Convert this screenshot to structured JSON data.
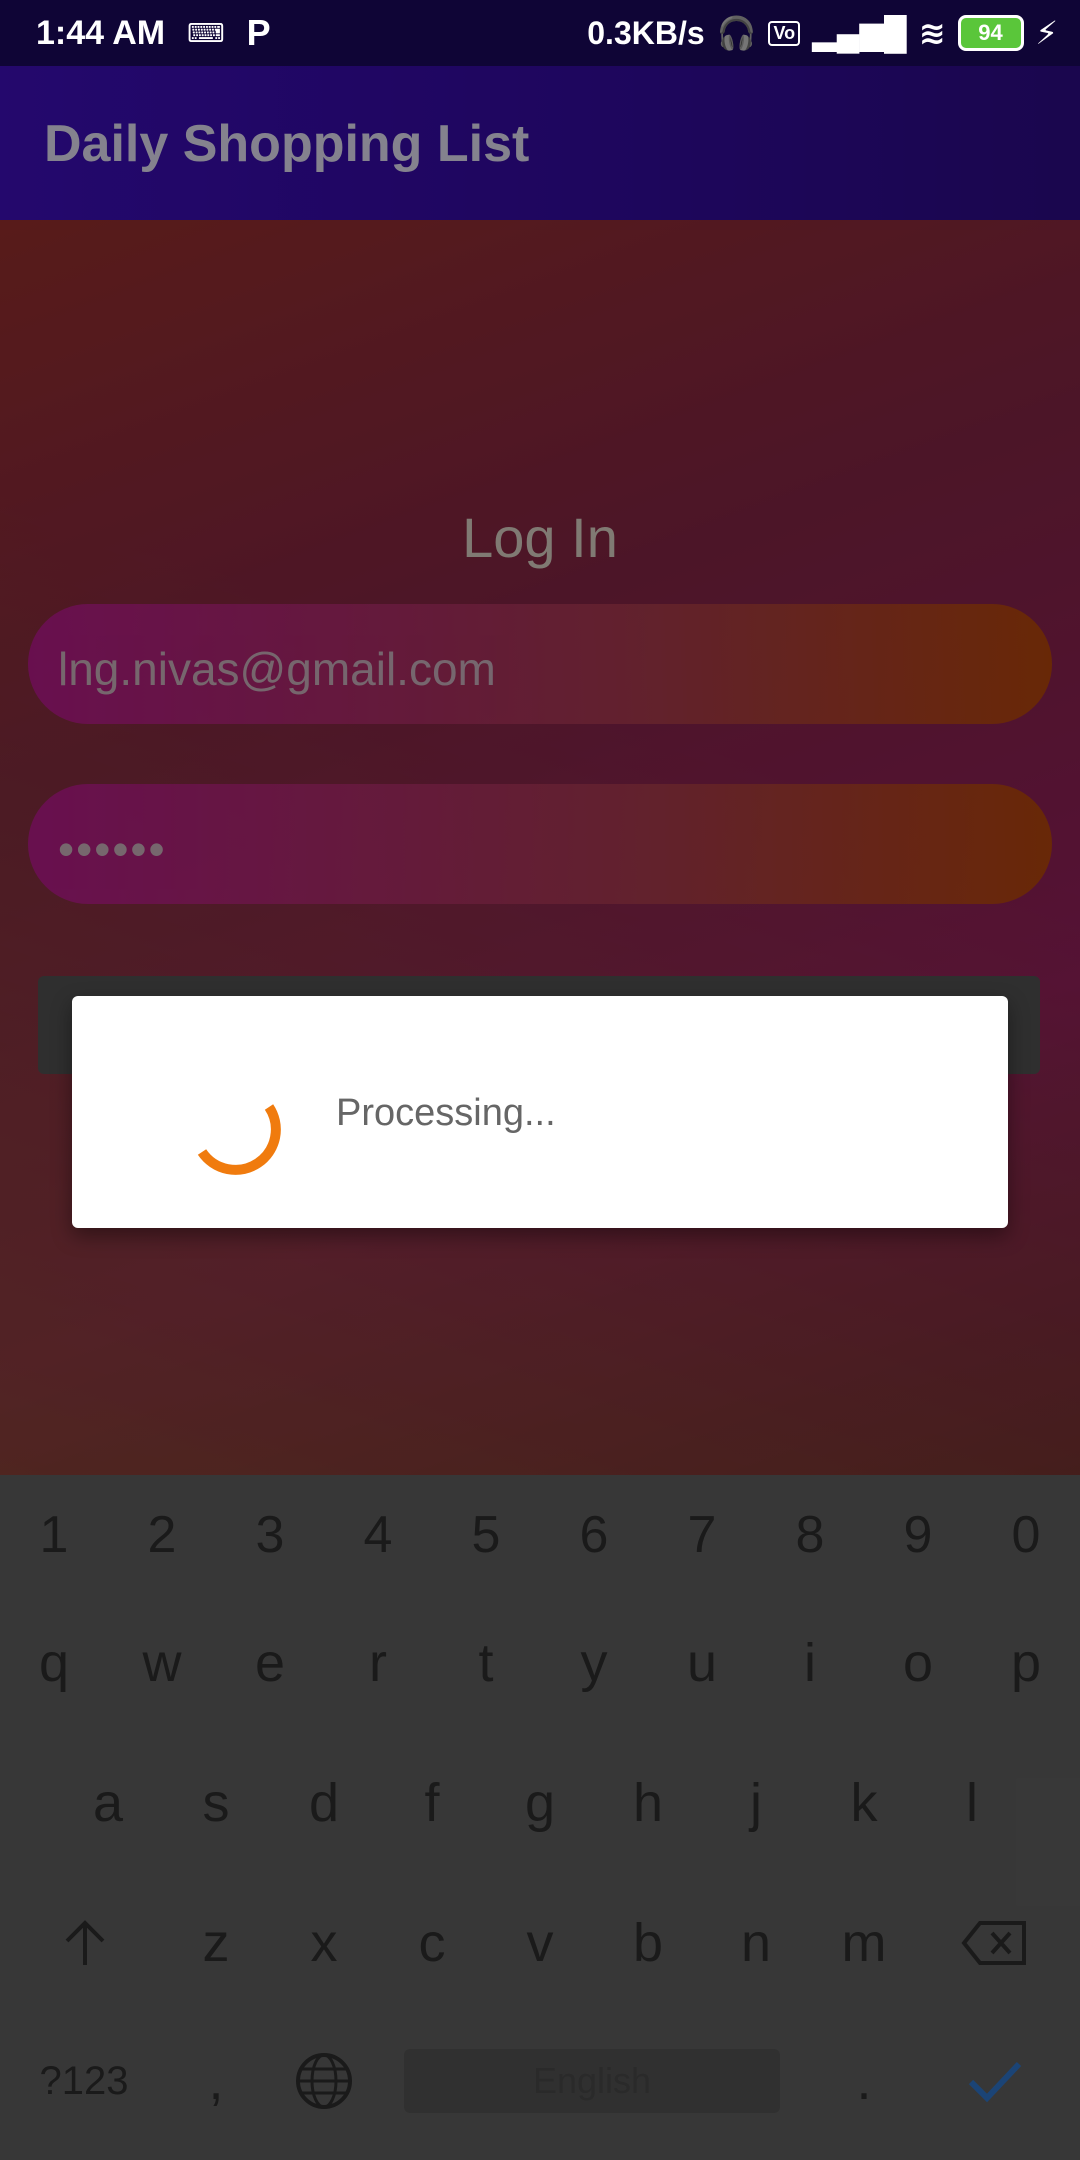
{
  "status_bar": {
    "time": "1:44 AM",
    "net_speed": "0.3KB/s",
    "battery": "94"
  },
  "app": {
    "title": "Daily Shopping List"
  },
  "login": {
    "title": "Log In",
    "email_value": "lng.nivas@gmail.com",
    "password_value": "••••••"
  },
  "dialog": {
    "message": "Processing...",
    "accent": "#f07b0e"
  },
  "keyboard": {
    "numbers": [
      "1",
      "2",
      "3",
      "4",
      "5",
      "6",
      "7",
      "8",
      "9",
      "0"
    ],
    "row1": [
      "q",
      "w",
      "e",
      "r",
      "t",
      "y",
      "u",
      "i",
      "o",
      "p"
    ],
    "row2": [
      "a",
      "s",
      "d",
      "f",
      "g",
      "h",
      "j",
      "k",
      "l"
    ],
    "row3": [
      "z",
      "x",
      "c",
      "v",
      "b",
      "n",
      "m"
    ],
    "symbols_key": "?123",
    "comma": ",",
    "space_label": "English",
    "period": "."
  }
}
